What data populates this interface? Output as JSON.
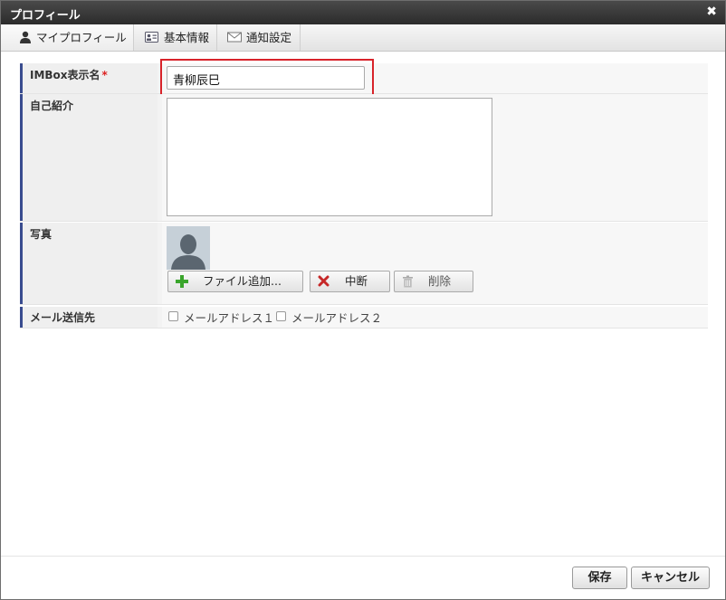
{
  "dialog": {
    "title": "プロフィール"
  },
  "tabs": [
    {
      "label": "マイプロフィール",
      "icon": "person-icon"
    },
    {
      "label": "基本情報",
      "icon": "id-card-icon"
    },
    {
      "label": "通知設定",
      "icon": "envelope-icon"
    }
  ],
  "form": {
    "display_name": {
      "label": "IMBox表示名",
      "required_mark": "*",
      "value": "青柳辰巳"
    },
    "self_intro": {
      "label": "自己紹介",
      "value": ""
    },
    "photo": {
      "label": "写真",
      "add_button": "ファイル追加...",
      "cancel_button": "中断",
      "delete_button": "削除"
    },
    "mail_to": {
      "label": "メール送信先",
      "options": [
        {
          "label": "メールアドレス１",
          "checked": false
        },
        {
          "label": "メールアドレス２",
          "checked": false
        }
      ]
    }
  },
  "footer": {
    "save_label": "保存",
    "cancel_label": "キャンセル"
  },
  "colors": {
    "accent": "#394c8f",
    "highlight": "#d8232a",
    "titlebar": "#333333"
  }
}
